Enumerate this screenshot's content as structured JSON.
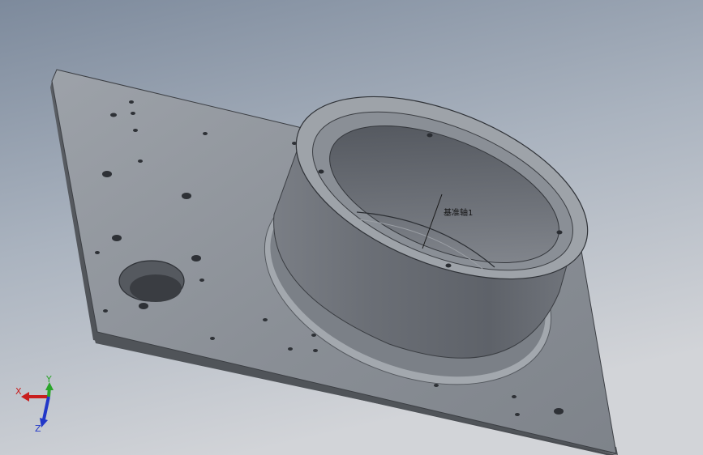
{
  "viewport": {
    "background_top": "#9aa6b5",
    "background_bottom": "#c5c8cd",
    "part_color": "#8e939b"
  },
  "reference_axis": {
    "label": "基准轴1"
  },
  "triad": {
    "x_label": "X",
    "y_label": "Y",
    "z_label": "Z",
    "x_color": "#c81e1e",
    "y_color": "#2aa52a",
    "z_color": "#2238c8"
  }
}
